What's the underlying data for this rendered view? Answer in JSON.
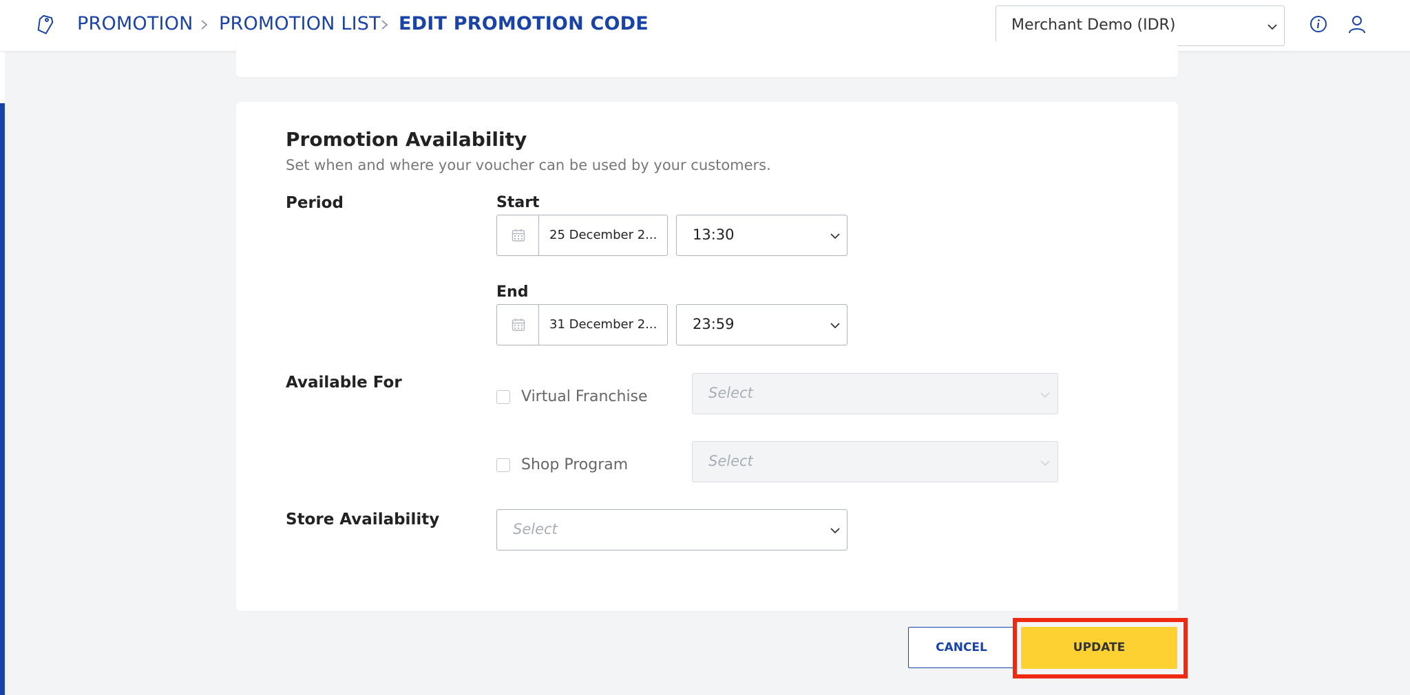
{
  "header": {
    "breadcrumb": [
      "PROMOTION",
      "PROMOTION LIST",
      "EDIT PROMOTION CODE"
    ],
    "merchant_select": "Merchant Demo (IDR)",
    "icons": [
      "tag-icon",
      "info-icon",
      "user-icon"
    ]
  },
  "availability": {
    "title": "Promotion Availability",
    "description": "Set when and where your voucher can be used by your customers.",
    "period_label": "Period",
    "start_label": "Start",
    "start_date": "25 December 2...",
    "start_time": "13:30",
    "end_label": "End",
    "end_date": "31 December 2...",
    "end_time": "23:59",
    "available_for_label": "Available For",
    "options": [
      {
        "label": "Virtual Franchise",
        "checked": false,
        "select_placeholder": "Select"
      },
      {
        "label": "Shop Program",
        "checked": false,
        "select_placeholder": "Select"
      }
    ],
    "store_availability_label": "Store Availability",
    "store_placeholder": "Select"
  },
  "actions": {
    "cancel": "CANCEL",
    "update": "UPDATE"
  },
  "colors": {
    "brand_blue": "#1a43a8",
    "update_yellow": "#fdd131",
    "highlight_red": "#ef2a12"
  }
}
